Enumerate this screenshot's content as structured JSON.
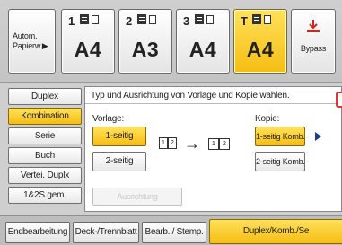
{
  "trays": {
    "auto": {
      "label_line1": "Autom.",
      "label_line2": "Papierw.▶"
    },
    "tray1": {
      "number": "1",
      "size": "A4"
    },
    "tray2": {
      "number": "2",
      "size": "A3"
    },
    "tray3": {
      "number": "3",
      "size": "A4"
    },
    "trayT": {
      "number": "T",
      "size": "A4",
      "selected": true
    },
    "bypass": {
      "label": "Bypass",
      "icon": "bypass-tray-icon"
    }
  },
  "side_menu": {
    "items": [
      {
        "label": "Duplex"
      },
      {
        "label": "Kombination",
        "active": true
      },
      {
        "label": "Serie"
      },
      {
        "label": "Buch"
      },
      {
        "label": "Vertei. Duplx"
      },
      {
        "label": "1&2S.gem."
      }
    ]
  },
  "content": {
    "instruction": "Typ und Ausrichtung von Vorlage und Kopie wählen.",
    "original": {
      "label": "Vorlage:",
      "options": [
        {
          "label": "1-seitig",
          "selected": true
        },
        {
          "label": "2-seitig"
        }
      ],
      "icon_pages": [
        "1",
        "2"
      ]
    },
    "copy": {
      "label": "Kopie:",
      "options": [
        {
          "label": "1-seitig Komb.",
          "selected": true
        },
        {
          "label": "2-seitig Komb."
        }
      ],
      "icon_pages": [
        "1",
        "2"
      ]
    },
    "arrow": "→",
    "orientation_button": "Ausrichtung"
  },
  "tabs": [
    {
      "label": "Endbearbeitung"
    },
    {
      "label": "Deck-/Trennblatt"
    },
    {
      "label": "Bearb. / Stemp."
    },
    {
      "label": "Duplex/Komb./Se",
      "active": true
    }
  ],
  "colors": {
    "selected": "#f5bd14",
    "arrow": "#1a3c8c",
    "bypass_icon": "#d0261e"
  }
}
